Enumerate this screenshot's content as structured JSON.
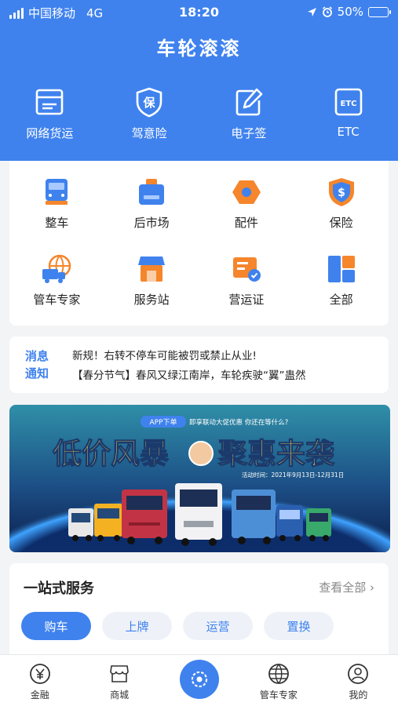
{
  "status_bar": {
    "carrier": "中国移动",
    "network": "4G",
    "time": "18:20",
    "battery": "50%",
    "battery_level": 0.5
  },
  "app_title": "车轮滚滚",
  "top_services": [
    {
      "label": "网络货运",
      "icon": "freight-doc-icon"
    },
    {
      "label": "驾意险",
      "icon": "insurance-shield-icon"
    },
    {
      "label": "电子签",
      "icon": "e-sign-icon"
    },
    {
      "label": "ETC",
      "icon": "etc-icon"
    }
  ],
  "grid": [
    {
      "label": "整车",
      "icon": "truck-icon"
    },
    {
      "label": "后市场",
      "icon": "aftermarket-box-icon"
    },
    {
      "label": "配件",
      "icon": "parts-nut-icon"
    },
    {
      "label": "保险",
      "icon": "dollar-shield-icon"
    },
    {
      "label": "管车专家",
      "icon": "globe-truck-icon"
    },
    {
      "label": "服务站",
      "icon": "service-station-icon"
    },
    {
      "label": "营运证",
      "icon": "certificate-icon"
    },
    {
      "label": "全部",
      "icon": "all-grid-icon"
    }
  ],
  "notice": {
    "tag_line1": "消息",
    "tag_line2": "通知",
    "items": [
      "新规！右转不停车可能被罚或禁止从业!",
      "【春分节气】春风又绿江南岸，车轮疾驶“翼”蛊然"
    ]
  },
  "banner": {
    "badge": "APP下单",
    "subtitle": "即享联动大促优惠  你还在等什么?",
    "headline_left": "低价风暴",
    "headline_right": "聚惠来袭",
    "date_text": "活动时间：2021年9月13日-12月31日"
  },
  "one_stop": {
    "title": "一站式服务",
    "more": "查看全部",
    "tabs": [
      "购车",
      "上牌",
      "运营",
      "置换"
    ],
    "active_tab": 0
  },
  "tabbar": [
    {
      "label": "金融",
      "icon": "yuan-icon"
    },
    {
      "label": "商城",
      "icon": "store-icon"
    },
    {
      "label": "",
      "icon": "center-logo-icon"
    },
    {
      "label": "管车专家",
      "icon": "globe-icon"
    },
    {
      "label": "我的",
      "icon": "profile-icon"
    }
  ],
  "colors": {
    "primary": "#3f82ee",
    "orange": "#f5862c",
    "background": "#f3f4f6"
  }
}
